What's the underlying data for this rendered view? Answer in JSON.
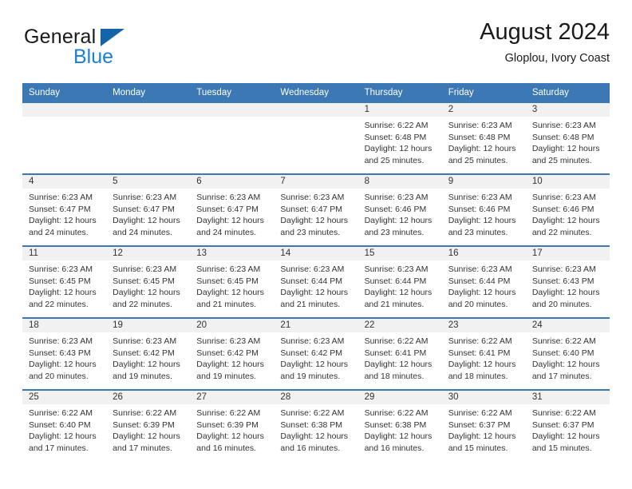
{
  "brand": {
    "name_top": "General",
    "name_bottom": "Blue",
    "logo_icon": "triangle-logo-icon"
  },
  "header": {
    "title": "August 2024",
    "subtitle": "Gloplou, Ivory Coast"
  },
  "colors": {
    "header_blue": "#3b78b4",
    "brand_blue": "#1a7fd4",
    "daynum_gray": "#f1f1f1",
    "text": "#333333"
  },
  "weekdays": [
    "Sunday",
    "Monday",
    "Tuesday",
    "Wednesday",
    "Thursday",
    "Friday",
    "Saturday"
  ],
  "weeks": [
    [
      {
        "day": "",
        "blank": true
      },
      {
        "day": "",
        "blank": true
      },
      {
        "day": "",
        "blank": true
      },
      {
        "day": "",
        "blank": true
      },
      {
        "day": "1",
        "sunrise": "Sunrise: 6:22 AM",
        "sunset": "Sunset: 6:48 PM",
        "daylight": "Daylight: 12 hours and 25 minutes."
      },
      {
        "day": "2",
        "sunrise": "Sunrise: 6:23 AM",
        "sunset": "Sunset: 6:48 PM",
        "daylight": "Daylight: 12 hours and 25 minutes."
      },
      {
        "day": "3",
        "sunrise": "Sunrise: 6:23 AM",
        "sunset": "Sunset: 6:48 PM",
        "daylight": "Daylight: 12 hours and 25 minutes."
      }
    ],
    [
      {
        "day": "4",
        "sunrise": "Sunrise: 6:23 AM",
        "sunset": "Sunset: 6:47 PM",
        "daylight": "Daylight: 12 hours and 24 minutes."
      },
      {
        "day": "5",
        "sunrise": "Sunrise: 6:23 AM",
        "sunset": "Sunset: 6:47 PM",
        "daylight": "Daylight: 12 hours and 24 minutes."
      },
      {
        "day": "6",
        "sunrise": "Sunrise: 6:23 AM",
        "sunset": "Sunset: 6:47 PM",
        "daylight": "Daylight: 12 hours and 24 minutes."
      },
      {
        "day": "7",
        "sunrise": "Sunrise: 6:23 AM",
        "sunset": "Sunset: 6:47 PM",
        "daylight": "Daylight: 12 hours and 23 minutes."
      },
      {
        "day": "8",
        "sunrise": "Sunrise: 6:23 AM",
        "sunset": "Sunset: 6:46 PM",
        "daylight": "Daylight: 12 hours and 23 minutes."
      },
      {
        "day": "9",
        "sunrise": "Sunrise: 6:23 AM",
        "sunset": "Sunset: 6:46 PM",
        "daylight": "Daylight: 12 hours and 23 minutes."
      },
      {
        "day": "10",
        "sunrise": "Sunrise: 6:23 AM",
        "sunset": "Sunset: 6:46 PM",
        "daylight": "Daylight: 12 hours and 22 minutes."
      }
    ],
    [
      {
        "day": "11",
        "sunrise": "Sunrise: 6:23 AM",
        "sunset": "Sunset: 6:45 PM",
        "daylight": "Daylight: 12 hours and 22 minutes."
      },
      {
        "day": "12",
        "sunrise": "Sunrise: 6:23 AM",
        "sunset": "Sunset: 6:45 PM",
        "daylight": "Daylight: 12 hours and 22 minutes."
      },
      {
        "day": "13",
        "sunrise": "Sunrise: 6:23 AM",
        "sunset": "Sunset: 6:45 PM",
        "daylight": "Daylight: 12 hours and 21 minutes."
      },
      {
        "day": "14",
        "sunrise": "Sunrise: 6:23 AM",
        "sunset": "Sunset: 6:44 PM",
        "daylight": "Daylight: 12 hours and 21 minutes."
      },
      {
        "day": "15",
        "sunrise": "Sunrise: 6:23 AM",
        "sunset": "Sunset: 6:44 PM",
        "daylight": "Daylight: 12 hours and 21 minutes."
      },
      {
        "day": "16",
        "sunrise": "Sunrise: 6:23 AM",
        "sunset": "Sunset: 6:44 PM",
        "daylight": "Daylight: 12 hours and 20 minutes."
      },
      {
        "day": "17",
        "sunrise": "Sunrise: 6:23 AM",
        "sunset": "Sunset: 6:43 PM",
        "daylight": "Daylight: 12 hours and 20 minutes."
      }
    ],
    [
      {
        "day": "18",
        "sunrise": "Sunrise: 6:23 AM",
        "sunset": "Sunset: 6:43 PM",
        "daylight": "Daylight: 12 hours and 20 minutes."
      },
      {
        "day": "19",
        "sunrise": "Sunrise: 6:23 AM",
        "sunset": "Sunset: 6:42 PM",
        "daylight": "Daylight: 12 hours and 19 minutes."
      },
      {
        "day": "20",
        "sunrise": "Sunrise: 6:23 AM",
        "sunset": "Sunset: 6:42 PM",
        "daylight": "Daylight: 12 hours and 19 minutes."
      },
      {
        "day": "21",
        "sunrise": "Sunrise: 6:23 AM",
        "sunset": "Sunset: 6:42 PM",
        "daylight": "Daylight: 12 hours and 19 minutes."
      },
      {
        "day": "22",
        "sunrise": "Sunrise: 6:22 AM",
        "sunset": "Sunset: 6:41 PM",
        "daylight": "Daylight: 12 hours and 18 minutes."
      },
      {
        "day": "23",
        "sunrise": "Sunrise: 6:22 AM",
        "sunset": "Sunset: 6:41 PM",
        "daylight": "Daylight: 12 hours and 18 minutes."
      },
      {
        "day": "24",
        "sunrise": "Sunrise: 6:22 AM",
        "sunset": "Sunset: 6:40 PM",
        "daylight": "Daylight: 12 hours and 17 minutes."
      }
    ],
    [
      {
        "day": "25",
        "sunrise": "Sunrise: 6:22 AM",
        "sunset": "Sunset: 6:40 PM",
        "daylight": "Daylight: 12 hours and 17 minutes."
      },
      {
        "day": "26",
        "sunrise": "Sunrise: 6:22 AM",
        "sunset": "Sunset: 6:39 PM",
        "daylight": "Daylight: 12 hours and 17 minutes."
      },
      {
        "day": "27",
        "sunrise": "Sunrise: 6:22 AM",
        "sunset": "Sunset: 6:39 PM",
        "daylight": "Daylight: 12 hours and 16 minutes."
      },
      {
        "day": "28",
        "sunrise": "Sunrise: 6:22 AM",
        "sunset": "Sunset: 6:38 PM",
        "daylight": "Daylight: 12 hours and 16 minutes."
      },
      {
        "day": "29",
        "sunrise": "Sunrise: 6:22 AM",
        "sunset": "Sunset: 6:38 PM",
        "daylight": "Daylight: 12 hours and 16 minutes."
      },
      {
        "day": "30",
        "sunrise": "Sunrise: 6:22 AM",
        "sunset": "Sunset: 6:37 PM",
        "daylight": "Daylight: 12 hours and 15 minutes."
      },
      {
        "day": "31",
        "sunrise": "Sunrise: 6:22 AM",
        "sunset": "Sunset: 6:37 PM",
        "daylight": "Daylight: 12 hours and 15 minutes."
      }
    ]
  ]
}
